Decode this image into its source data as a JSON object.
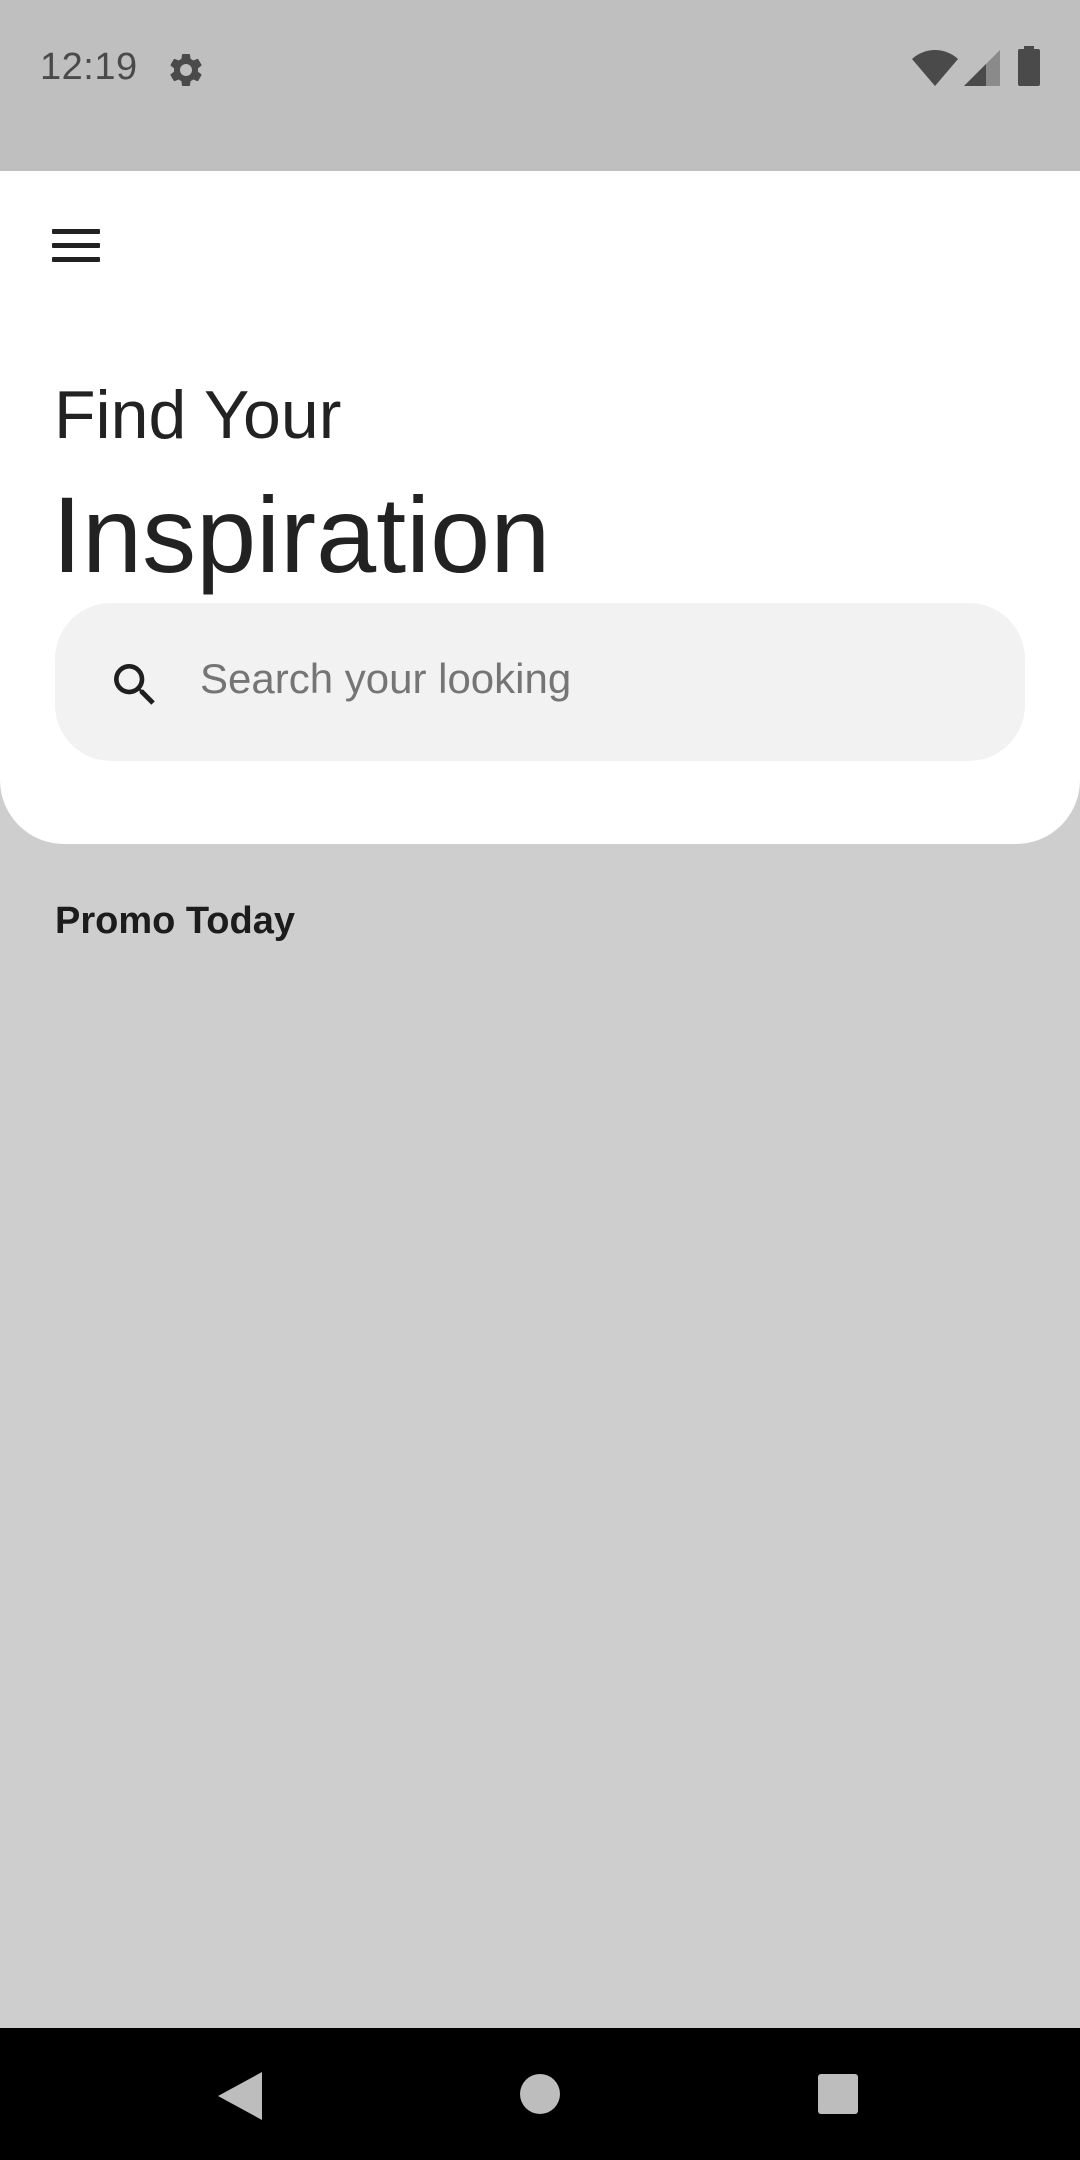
{
  "status_bar": {
    "time": "12:19",
    "icons": [
      "gear-icon",
      "wifi-icon",
      "signal-icon",
      "battery-icon"
    ]
  },
  "header": {
    "menu_icon": "hamburger-menu-icon",
    "title_line1": "Find Your",
    "title_line2": "Inspiration"
  },
  "search": {
    "icon": "search-icon",
    "placeholder": "Search your looking",
    "value": ""
  },
  "sections": {
    "promo_title": "Promo Today"
  },
  "nav_bar": {
    "icons": [
      "back-icon",
      "home-icon",
      "recents-icon"
    ]
  },
  "colors": {
    "status_bar_bg": "#bfbfbf",
    "page_bg": "#cecece",
    "card_bg": "#ffffff",
    "search_bg": "#f2f2f2",
    "text_primary": "#222222",
    "nav_bar_bg": "#000000"
  }
}
